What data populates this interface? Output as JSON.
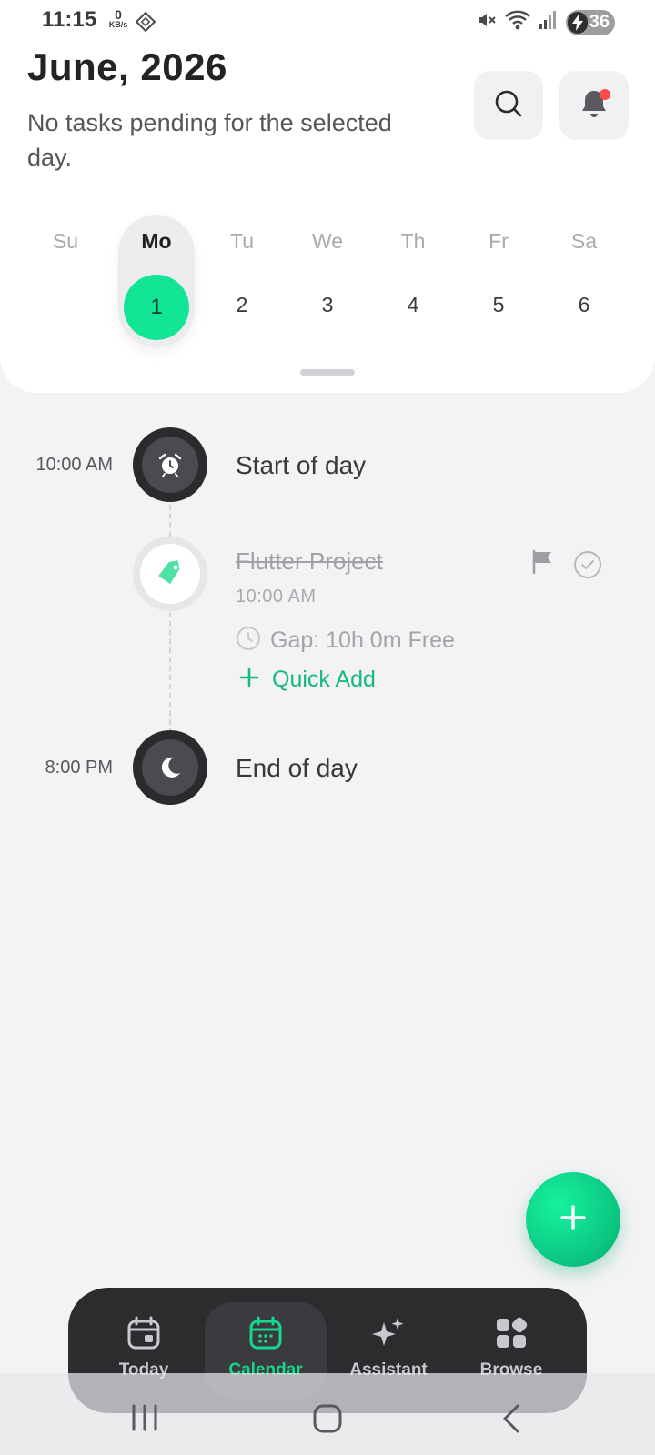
{
  "status_bar": {
    "time": "11:15",
    "net_speed_value": "0",
    "net_speed_unit": "KB/s",
    "battery_level": "36"
  },
  "header": {
    "month_title": "June, 2026",
    "subtitle": "No tasks pending for the selected day."
  },
  "week": {
    "days": [
      {
        "name": "Su",
        "number": ""
      },
      {
        "name": "Mo",
        "number": "1"
      },
      {
        "name": "Tu",
        "number": "2"
      },
      {
        "name": "We",
        "number": "3"
      },
      {
        "name": "Th",
        "number": "4"
      },
      {
        "name": "Fr",
        "number": "5"
      },
      {
        "name": "Sa",
        "number": "6"
      }
    ],
    "selected_index": 1
  },
  "timeline": {
    "start": {
      "time": "10:00 AM",
      "title": "Start of day",
      "icon": "alarm-clock-icon"
    },
    "task": {
      "title": "Flutter Project",
      "time": "10:00 AM",
      "icon": "tag-icon",
      "completed": true
    },
    "gap": {
      "text": "Gap: 10h 0m Free",
      "icon": "clock-icon"
    },
    "quick_add": {
      "label": "Quick Add"
    },
    "end": {
      "time": "8:00 PM",
      "title": "End of day",
      "icon": "moon-icon"
    }
  },
  "bottom_nav": {
    "items": [
      {
        "label": "Today",
        "icon": "calendar-day-icon"
      },
      {
        "label": "Calendar",
        "icon": "calendar-grid-icon"
      },
      {
        "label": "Assistant",
        "icon": "sparkles-icon"
      },
      {
        "label": "Browse",
        "icon": "grid-icon"
      }
    ],
    "active_index": 1
  },
  "colors": {
    "accent": "#12e596",
    "accent_text": "#17b97c",
    "background": "#f3f3f5",
    "dark_node": "#2b2b2e",
    "notification_dot": "#ff4b4b"
  }
}
